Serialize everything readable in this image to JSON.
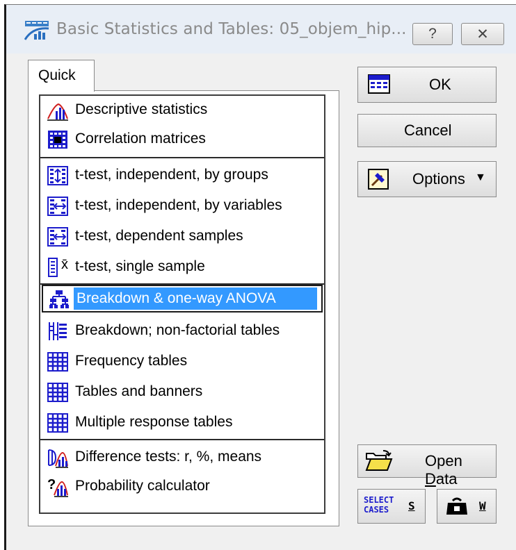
{
  "window": {
    "title": "Basic Statistics and Tables: 05_objem_hip...",
    "help_label": "?",
    "close_label": "✕"
  },
  "tab": {
    "label": "Quick"
  },
  "list": {
    "items": [
      {
        "label": "Descriptive statistics",
        "icon": "descriptive-stats-icon"
      },
      {
        "label": "Correlation matrices",
        "icon": "correlation-matrix-icon"
      },
      {
        "label": "t-test, independent, by groups",
        "icon": "t-test-groups-icon"
      },
      {
        "label": "t-test, independent, by variables",
        "icon": "t-test-variables-icon"
      },
      {
        "label": "t-test, dependent samples",
        "icon": "t-test-dependent-icon"
      },
      {
        "label": "t-test, single sample",
        "icon": "t-test-single-icon"
      },
      {
        "label": "Breakdown & one-way ANOVA",
        "icon": "breakdown-anova-icon",
        "selected": true
      },
      {
        "label": "Breakdown; non-factorial tables",
        "icon": "breakdown-tables-icon"
      },
      {
        "label": "Frequency tables",
        "icon": "frequency-tables-icon"
      },
      {
        "label": "Tables and banners",
        "icon": "tables-banners-icon"
      },
      {
        "label": "Multiple response tables",
        "icon": "multiple-response-icon"
      },
      {
        "label": "Difference tests: r, %, means",
        "icon": "difference-tests-icon"
      },
      {
        "label": "Probability calculator",
        "icon": "probability-calculator-icon"
      }
    ],
    "xbar_glyph": "x̄"
  },
  "buttons": {
    "ok": "OK",
    "cancel": "Cancel",
    "options": "Options",
    "options_arrow": "▼",
    "open_data_prefix": "Open ",
    "open_data_underlined": "D",
    "open_data_suffix": "ata",
    "select_cases_line1": "SELECT",
    "select_cases_line2": "CASES",
    "select_cases_key": "S",
    "weight_key": "W"
  },
  "colors": {
    "selection": "#3399ff",
    "icon_blue": "#1c1ccc",
    "title_text": "#8a8a8a"
  }
}
